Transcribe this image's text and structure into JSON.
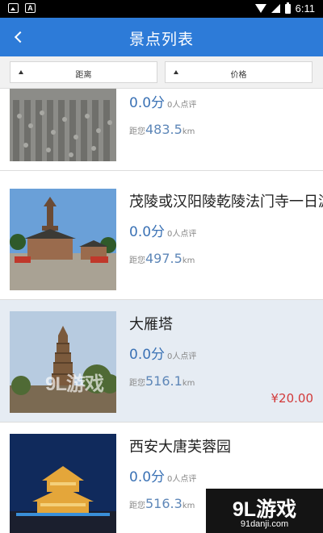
{
  "status_bar": {
    "time": "6:11",
    "icons": [
      "image-icon",
      "a-icon",
      "wifi-icon",
      "signal-icon",
      "battery-icon"
    ]
  },
  "app_bar": {
    "title": "景点列表",
    "back_icon": "chevron-left-icon"
  },
  "sort_bar": {
    "distance_label": "距离",
    "price_label": "价格"
  },
  "list": {
    "items": [
      {
        "name": "",
        "score": "0.0分",
        "reviews": "0人点评",
        "dist_prefix": "距您",
        "distance": "483.5",
        "unit": "km",
        "price": ""
      },
      {
        "name": "茂陵或汉阳陵乾陵法门寺一日游",
        "score": "0.0分",
        "reviews": "0人点评",
        "dist_prefix": "距您",
        "distance": "497.5",
        "unit": "km",
        "price": ""
      },
      {
        "name": "大雁塔",
        "score": "0.0分",
        "reviews": "0人点评",
        "dist_prefix": "距您",
        "distance": "516.1",
        "unit": "km",
        "price": "¥20.00"
      },
      {
        "name": "西安大唐芙蓉园",
        "score": "0.0分",
        "reviews": "0人点评",
        "dist_prefix": "距您",
        "distance": "516.3",
        "unit": "km",
        "price": ""
      }
    ]
  },
  "watermark": {
    "left_text": "9L游戏",
    "big": "9L游戏",
    "small": "91danji.com"
  },
  "colors": {
    "primary": "#2d7bd8",
    "score": "#3b72b5",
    "price": "#d23a3a",
    "selected_bg": "#e6ecf3"
  }
}
